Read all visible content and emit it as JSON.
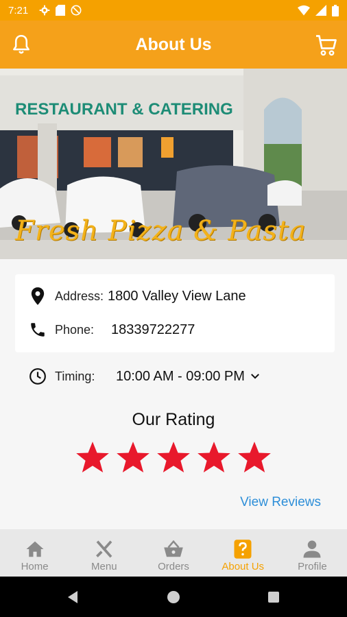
{
  "status_bar": {
    "time": "7:21"
  },
  "app_bar": {
    "title": "About Us"
  },
  "hero": {
    "sign_text": "RESTAURANT & CATERING",
    "banner_text": "Fresh Pizza & Pasta"
  },
  "info": {
    "address_label": "Address:",
    "address_value": "1800 Valley View Lane",
    "phone_label": "Phone:",
    "phone_value": "18339722277",
    "timing_label": "Timing:",
    "timing_value": "10:00 AM - 09:00 PM"
  },
  "rating": {
    "title": "Our Rating",
    "value": 5,
    "max": 5,
    "star_color": "#e8192c"
  },
  "view_reviews_label": "View Reviews",
  "bottom_nav": {
    "items": [
      {
        "label": "Home",
        "icon": "home-icon"
      },
      {
        "label": "Menu",
        "icon": "fork-knife-icon"
      },
      {
        "label": "Orders",
        "icon": "basket-icon"
      },
      {
        "label": "About Us",
        "icon": "question-icon",
        "active": true
      },
      {
        "label": "Profile",
        "icon": "person-icon"
      }
    ]
  },
  "colors": {
    "accent": "#f5a100",
    "link": "#2d8ed8",
    "star": "#e8192c"
  }
}
